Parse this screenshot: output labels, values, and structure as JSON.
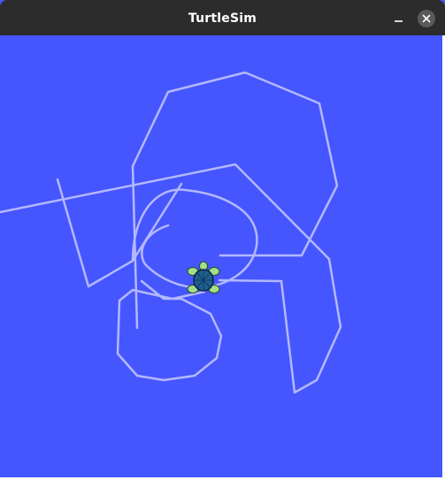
{
  "window": {
    "title": "TurtleSim"
  },
  "titlebar_buttons": {
    "minimize_icon": "minimize-icon",
    "close_icon": "close-icon"
  },
  "canvas": {
    "background_color": "#4556ff",
    "pen_color": "#b3b8ff",
    "turtle_icon": "turtle-icon"
  }
}
